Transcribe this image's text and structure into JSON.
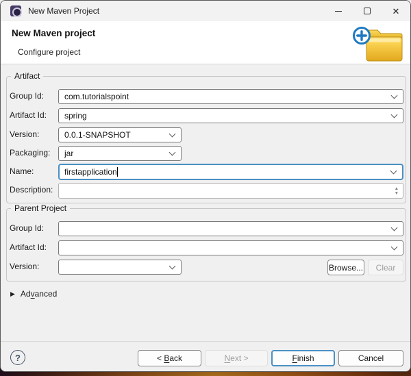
{
  "window": {
    "title": "New Maven Project"
  },
  "header": {
    "title": "New Maven project",
    "subtitle": "Configure project"
  },
  "artifact": {
    "legend": "Artifact",
    "fields": {
      "group_id": {
        "label": "Group Id:",
        "value": "com.tutorialspoint"
      },
      "artifact_id": {
        "label": "Artifact Id:",
        "value": "spring"
      },
      "version": {
        "label": "Version:",
        "value": "0.0.1-SNAPSHOT"
      },
      "packaging": {
        "label": "Packaging:",
        "value": "jar"
      },
      "name": {
        "label": "Name:",
        "value": "firstapplication"
      },
      "description": {
        "label": "Description:",
        "value": ""
      }
    }
  },
  "parent_project": {
    "legend": "Parent Project",
    "fields": {
      "group_id": {
        "label": "Group Id:",
        "value": ""
      },
      "artifact_id": {
        "label": "Artifact Id:",
        "value": ""
      },
      "version": {
        "label": "Version:",
        "value": ""
      }
    },
    "browse_label": "Browse...",
    "clear_label": "Clear"
  },
  "advanced": {
    "pre": "Ad",
    "u": "v",
    "post": "anced"
  },
  "footer": {
    "back": {
      "pre": "< ",
      "u": "B",
      "post": "ack"
    },
    "next": {
      "pre": "",
      "u": "N",
      "post": "ext >"
    },
    "finish": {
      "pre": "",
      "u": "F",
      "post": "inish"
    },
    "cancel": {
      "label": "Cancel"
    }
  },
  "icons": {
    "close": "✕",
    "help": "?",
    "advanced_arrow": "▶",
    "spinner_up": "▲",
    "spinner_down": "▼"
  },
  "colors": {
    "focus_accent": "#4a90c4",
    "folder_yellow": "#f2c12e",
    "badge_blue": "#1e7ac2",
    "dialog_bg": "#f0f0f0",
    "header_bg": "#ffffff"
  }
}
